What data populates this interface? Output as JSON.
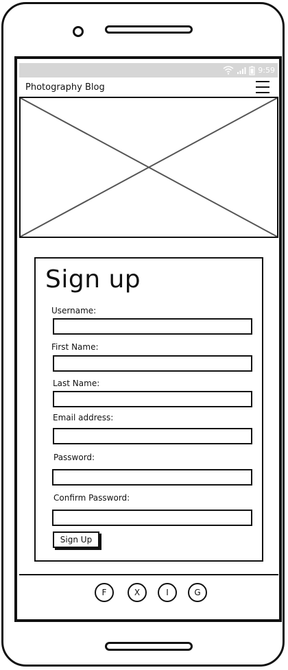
{
  "status_bar": {
    "time": "9:59",
    "icons": [
      "wifi-icon",
      "signal-icon",
      "battery-icon"
    ]
  },
  "navbar": {
    "brand": "Photography Blog",
    "menu_icon": "hamburger-menu-icon"
  },
  "hero": {
    "image": "image-placeholder"
  },
  "signup_form": {
    "title": "Sign up",
    "fields": [
      {
        "label": "Username:",
        "value": "",
        "placeholder": ""
      },
      {
        "label": "First Name:",
        "value": "",
        "placeholder": ""
      },
      {
        "label": "Last Name:",
        "value": "",
        "placeholder": ""
      },
      {
        "label": "Email address:",
        "value": "",
        "placeholder": ""
      },
      {
        "label": "Password:",
        "value": "",
        "placeholder": ""
      },
      {
        "label": "Confirm Password:",
        "value": "",
        "placeholder": ""
      }
    ],
    "submit_label": "Sign Up"
  },
  "footer": {
    "social_links": [
      {
        "label": "F",
        "icon": "facebook-icon"
      },
      {
        "label": "X",
        "icon": "x-icon"
      },
      {
        "label": "I",
        "icon": "instagram-icon"
      },
      {
        "label": "G",
        "icon": "github-icon"
      }
    ]
  }
}
